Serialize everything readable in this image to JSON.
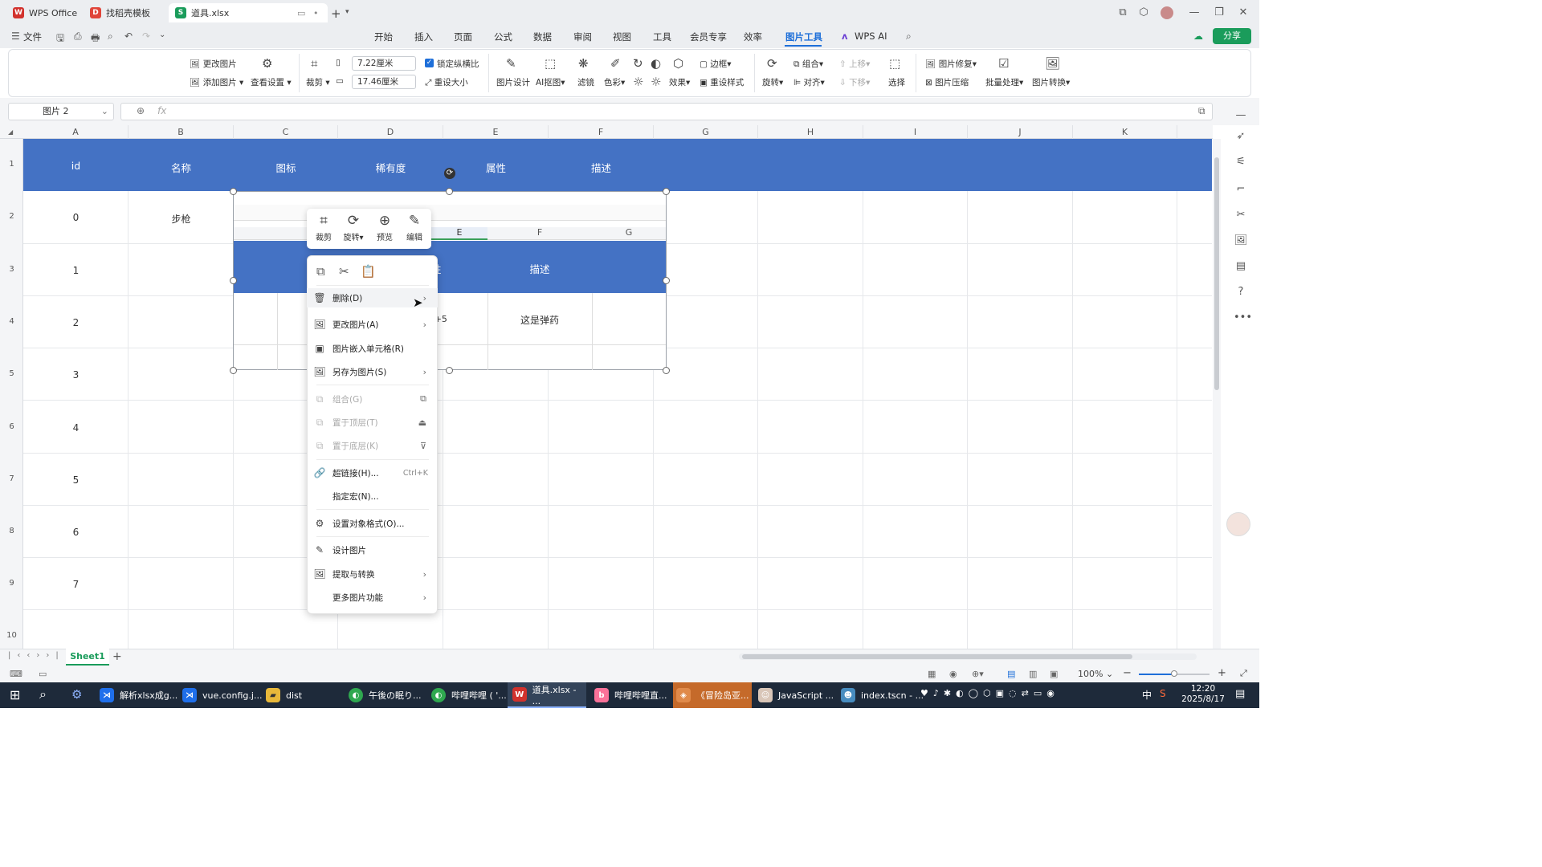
{
  "tabs": [
    {
      "label": "WPS Office"
    },
    {
      "label": "找稻壳模板"
    },
    {
      "label": "道具.xlsx"
    }
  ],
  "menu": {
    "file": "文件",
    "items": [
      "开始",
      "插入",
      "页面",
      "公式",
      "数据",
      "审阅",
      "视图",
      "工具",
      "会员专享",
      "效率",
      "图片工具",
      "WPS AI"
    ],
    "active": "图片工具",
    "share": "分享"
  },
  "ribbon": {
    "change_pic": "更改图片",
    "add_pic": "添加图片",
    "view_settings": "查看设置",
    "crop": "裁剪",
    "width": "7.22厘米",
    "height": "17.46厘米",
    "lock_ratio": "锁定纵横比",
    "reset_size": "重设大小",
    "pic_design": "图片设计",
    "ai_cutout": "AI抠图",
    "filter": "滤镜",
    "color": "色彩",
    "effect": "效果",
    "border": "边框",
    "reset_style": "重设样式",
    "rotate": "旋转",
    "group": "组合",
    "align": "对齐",
    "up": "上移",
    "down": "下移",
    "select": "选择",
    "pic_repair": "图片修复",
    "pic_compress": "图片压缩",
    "batch": "批量处理",
    "pic_convert": "图片转换"
  },
  "namebox": "图片 2",
  "fx": "fx",
  "columns": [
    "A",
    "B",
    "C",
    "D",
    "E",
    "F",
    "G",
    "H",
    "I",
    "J",
    "K"
  ],
  "rows": [
    "1",
    "2",
    "3",
    "4",
    "5",
    "6",
    "7",
    "8",
    "9",
    "10"
  ],
  "header_row": [
    "id",
    "名称",
    "图标",
    "稀有度",
    "属性",
    "描述"
  ],
  "col_a": [
    "0",
    "1",
    "2",
    "3",
    "4",
    "5",
    "6",
    "7"
  ],
  "b2": "步枪",
  "embedded": {
    "cols": [
      "E",
      "F",
      "G"
    ],
    "attr": "性",
    "desc": "描述",
    "val1": ":+5",
    "val2": "这是弹药"
  },
  "mini_toolbar": [
    "裁剪",
    "旋转",
    "预览",
    "编辑"
  ],
  "context_menu": {
    "delete": "删除(D)",
    "change": "更改图片(A)",
    "embed": "图片嵌入单元格(R)",
    "save_as": "另存为图片(S)",
    "group": "组合(G)",
    "to_top": "置于顶层(T)",
    "to_bottom": "置于底层(K)",
    "hyperlink": "超链接(H)...",
    "hyperlink_sc": "Ctrl+K",
    "macro": "指定宏(N)...",
    "format": "设置对象格式(O)...",
    "design": "设计图片",
    "extract": "提取与转换",
    "more": "更多图片功能"
  },
  "sheet": "Sheet1",
  "zoom": "100%",
  "taskbar": [
    "解析xlsx成g...",
    "vue.config.j...",
    "dist",
    "午後の眠り...",
    "哔哩哔哩 ( '...",
    "道具.xlsx - ...",
    "哔哩哔哩直...",
    "《冒险岛亚...",
    "JavaScript ...",
    "index.tscn - ..."
  ],
  "clock": {
    "time": "12:20",
    "date": "2025/8/17"
  },
  "tray_ime": "中",
  "accent": "#4472c4"
}
